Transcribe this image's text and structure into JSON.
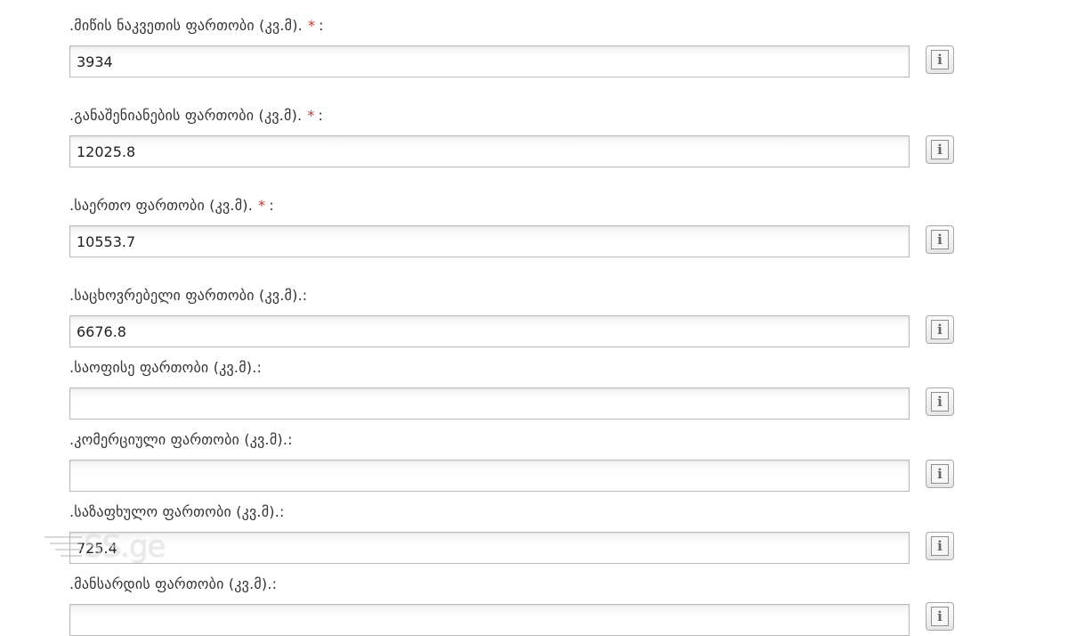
{
  "fields": [
    {
      "label": ".მიწის ნაკვეთის ფართობი (კვ.მ).",
      "required": true,
      "value": "3934"
    },
    {
      "label": ".განაშენიანების ფართობი (კვ.მ).",
      "required": true,
      "value": "12025.8"
    },
    {
      "label": ".საერთო ფართობი (კვ.მ).",
      "required": true,
      "value": "10553.7"
    },
    {
      "label": ".საცხოვრებელი ფართობი (კვ.მ).:",
      "required": false,
      "value": "6676.8"
    },
    {
      "label": ".საოფისე ფართობი (კვ.მ).:",
      "required": false,
      "value": ""
    },
    {
      "label": ".კომერციული ფართობი (კვ.მ).:",
      "required": false,
      "value": ""
    },
    {
      "label": ".საზაფხულო ფართობი (კვ.მ).:",
      "required": false,
      "value": "725.4"
    },
    {
      "label": ".მანსარდის ფართობი (კვ.მ).:",
      "required": false,
      "value": ""
    }
  ],
  "required_marker": "*",
  "required_suffix": ":",
  "info_icon_glyph": "i",
  "watermark": {
    "text": "SS.ge"
  },
  "colors": {
    "required": "#c0392b",
    "border": "#b9b9b9"
  }
}
